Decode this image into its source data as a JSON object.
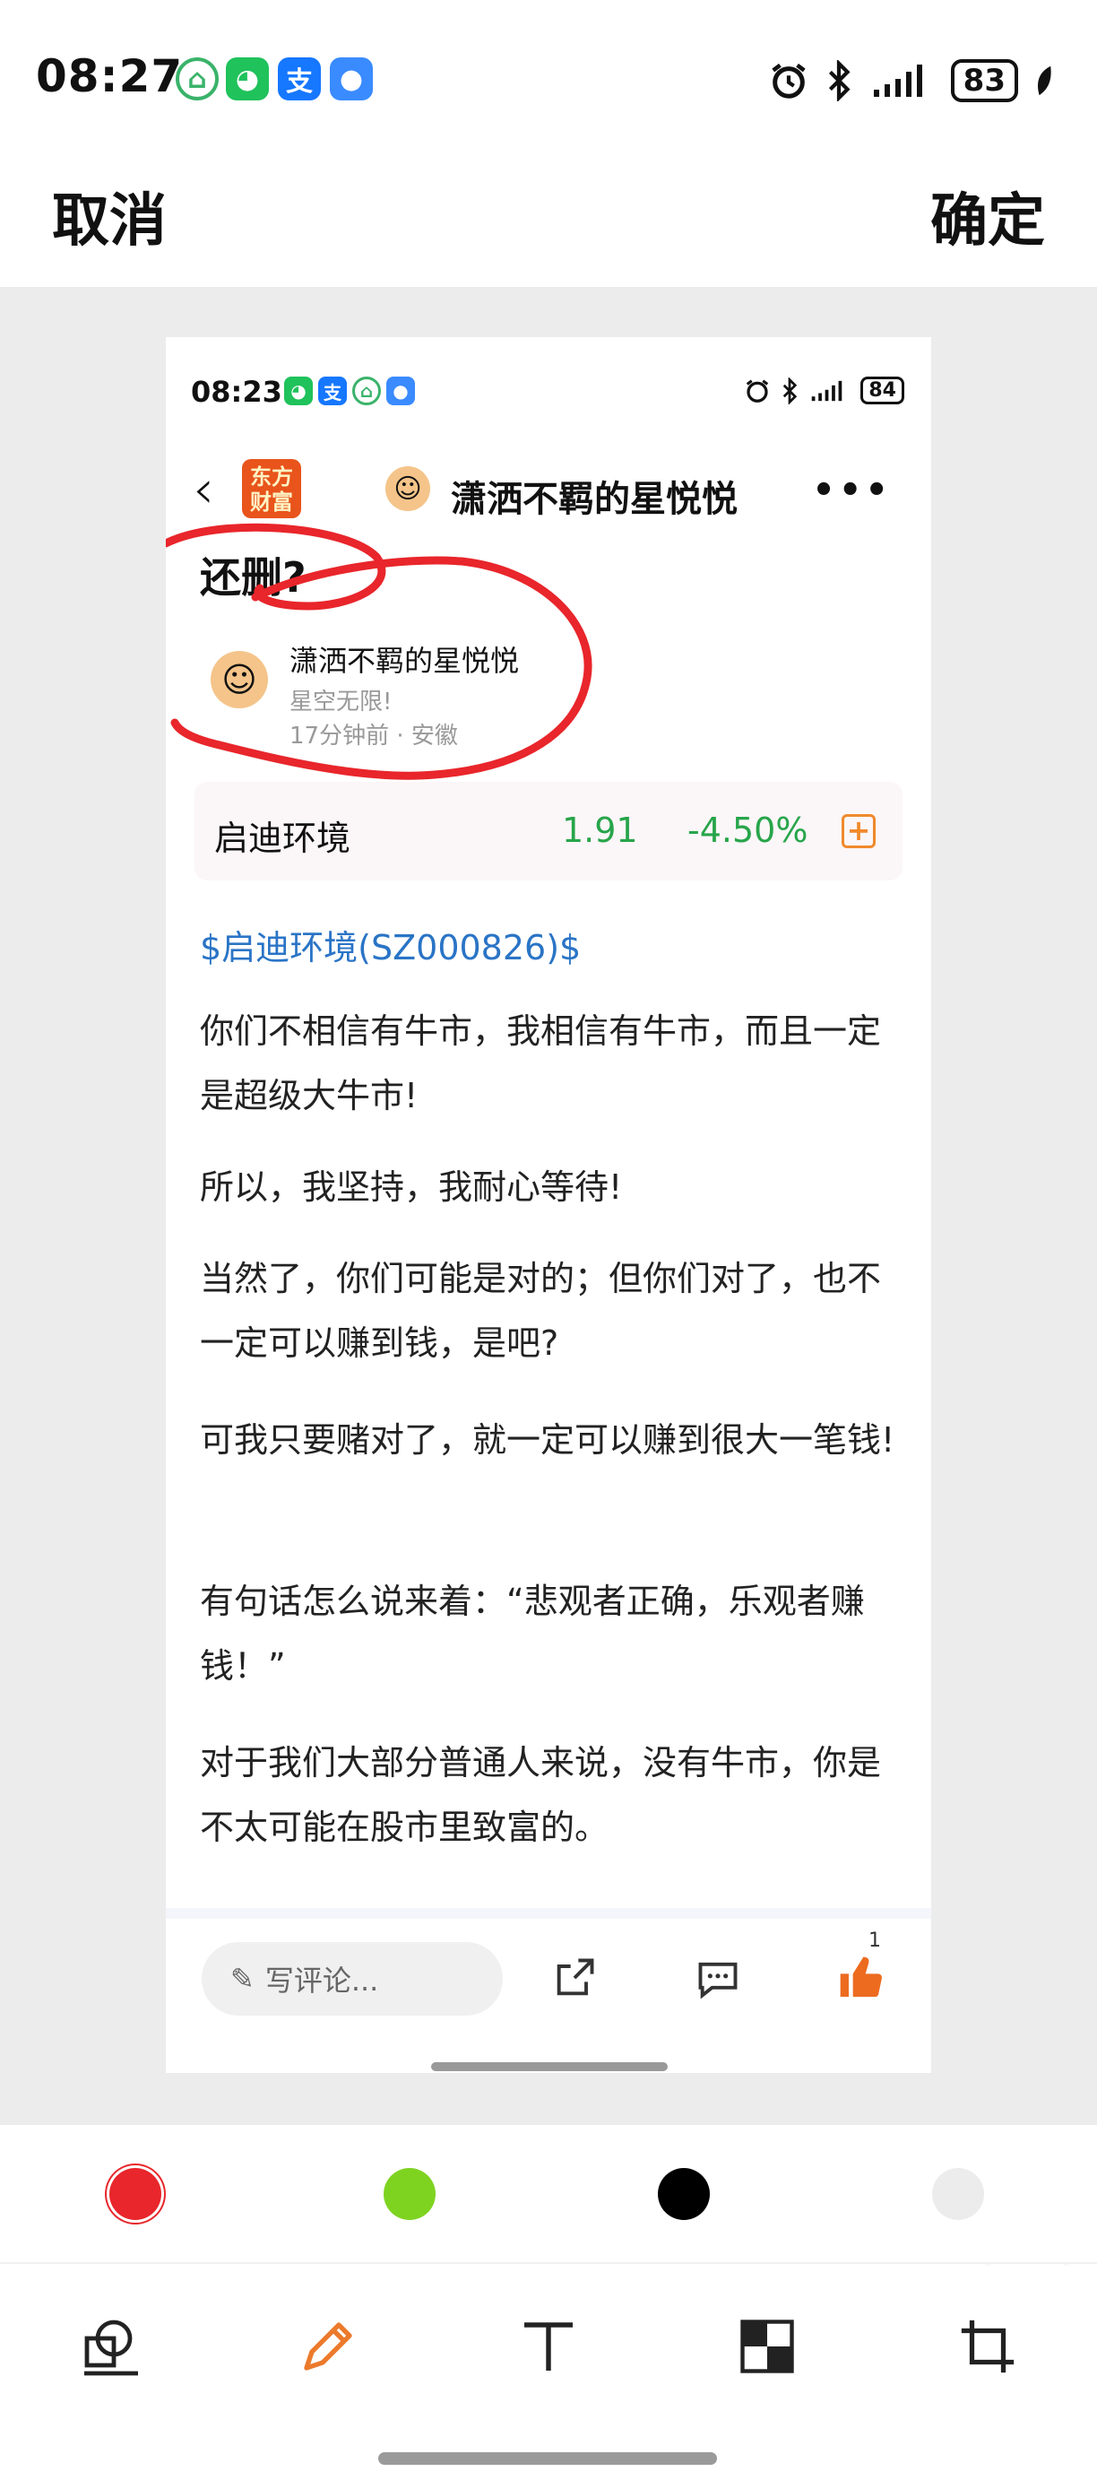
{
  "status_bar": {
    "time": "08:27",
    "battery": "83",
    "apps": [
      "green-leaf-icon",
      "wechat-icon",
      "alipay-icon",
      "message-icon"
    ]
  },
  "header": {
    "cancel": "取消",
    "confirm": "确定"
  },
  "screenshot": {
    "status": {
      "time": "08:23",
      "battery": "84"
    },
    "nav": {
      "logo_text": "东方财富",
      "title": "潇洒不羁的星悦悦",
      "more": "•••"
    },
    "post_title": "还删?",
    "author": {
      "name": "潇洒不羁的星悦悦",
      "signature": "星空无限!",
      "meta": "17分钟前 · 安徽"
    },
    "stock": {
      "name": "启迪环境",
      "price": "1.91",
      "change": "-4.50%"
    },
    "link": "$启迪环境(SZ000826)$",
    "paragraphs": [
      "你们不相信有牛市，我相信有牛市，而且一定是超级大牛市!",
      "所以，我坚持，我耐心等待!",
      "当然了，你们可能是对的；但你们对了，也不一定可以赚到钱，是吧?",
      "可我只要赌对了，就一定可以赚到很大一笔钱!",
      "有句话怎么说来着：“悲观者正确，乐观者赚钱！”",
      "对于我们大部分普通人来说，没有牛市，你是不太可能在股市里致富的。"
    ],
    "bottom": {
      "comment_placeholder": "写评论...",
      "like_count": "1"
    }
  },
  "palette": {
    "colors": [
      "#e8262b",
      "#7ed321",
      "#000000",
      "#ececec"
    ],
    "selected": "#e8262b"
  },
  "tools": [
    "shape-icon",
    "pen-icon",
    "text-icon",
    "mosaic-icon",
    "crop-icon"
  ],
  "colors": {
    "annotation_red": "#e8262b",
    "stock_green": "#27a54a",
    "link_blue": "#2a74c6",
    "accent_orange": "#f08a2c"
  }
}
